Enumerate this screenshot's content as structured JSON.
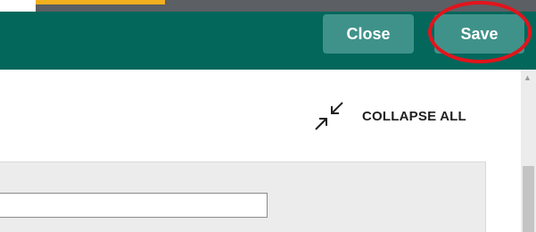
{
  "toolbar": {
    "close_label": "Close",
    "save_label": "Save"
  },
  "content": {
    "collapse_all_label": "COLLAPSE ALL",
    "collapse_icon": "collapse-arrows-icon",
    "panel_input": {
      "value": "",
      "placeholder": ""
    }
  },
  "colors": {
    "toolbar": "#03675c",
    "button": "#3f928a",
    "accent": "#f2b01e",
    "annotation": "#e2141c",
    "panel": "#ececec"
  }
}
